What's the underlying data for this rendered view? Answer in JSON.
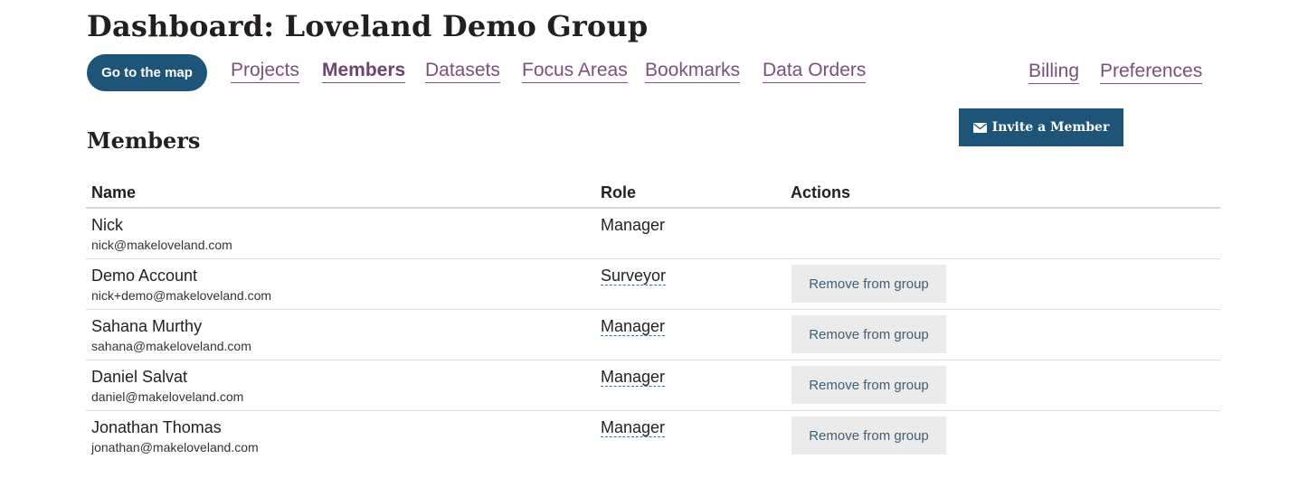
{
  "header": {
    "title": "Dashboard: Loveland Demo Group",
    "map_button": "Go to the map"
  },
  "nav": {
    "projects": "Projects",
    "members": "Members",
    "datasets": "Datasets",
    "focus_areas": "Focus Areas",
    "bookmarks": "Bookmarks",
    "data_orders": "Data Orders",
    "billing": "Billing",
    "preferences": "Preferences"
  },
  "members_section": {
    "title": "Members",
    "invite_button": "Invite a Member",
    "columns": {
      "name": "Name",
      "role": "Role",
      "actions": "Actions"
    },
    "rows": [
      {
        "name": "Nick",
        "email": "nick@makeloveland.com",
        "role": "Manager",
        "action": ""
      },
      {
        "name": "Demo Account",
        "email": "nick+demo@makeloveland.com",
        "role": "Surveyor",
        "action": "Remove from group"
      },
      {
        "name": "Sahana Murthy",
        "email": "sahana@makeloveland.com",
        "role": "Manager",
        "action": "Remove from group"
      },
      {
        "name": "Daniel Salvat",
        "email": "daniel@makeloveland.com",
        "role": "Manager",
        "action": "Remove from group"
      },
      {
        "name": "Jonathan Thomas",
        "email": "jonathan@makeloveland.com",
        "role": "Manager",
        "action": "Remove from group"
      }
    ]
  },
  "colors": {
    "primary": "#1e5478",
    "nav_link": "#7b4f7e",
    "text": "#231f20",
    "button_gray": "#ebebeb"
  },
  "icons": {
    "invite": "envelope-icon"
  }
}
